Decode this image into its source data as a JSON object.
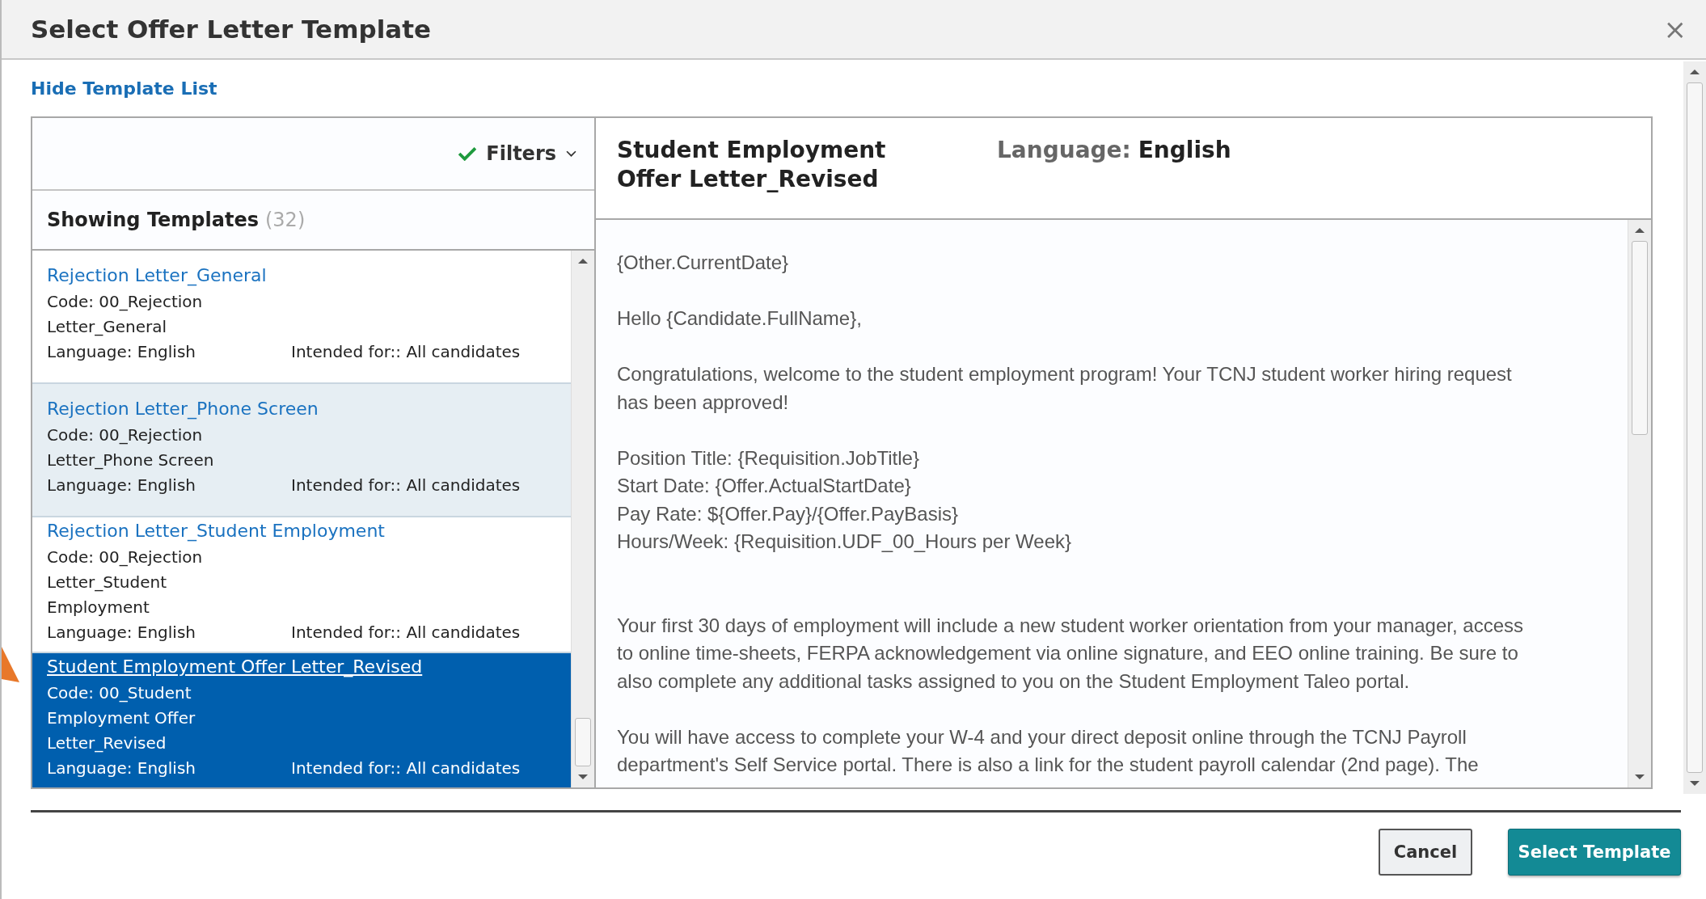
{
  "dialog": {
    "title": "Select Offer Letter Template",
    "close": "×"
  },
  "hide_link": "Hide Template List",
  "filters": {
    "label": "Filters",
    "active": true
  },
  "list": {
    "heading": "Showing Templates",
    "count": "(32)"
  },
  "templates": [
    {
      "title": "Rejection Letter_General",
      "code_lines": [
        "Code: 00_Rejection",
        "Letter_General"
      ],
      "language": "Language: English",
      "intended_for": "Intended for:: All candidates",
      "selected": false,
      "highlighted": false
    },
    {
      "title": "Rejection Letter_Phone Screen",
      "code_lines": [
        "Code: 00_Rejection",
        "Letter_Phone Screen"
      ],
      "language": "Language: English",
      "intended_for": "Intended for:: All candidates",
      "selected": false,
      "highlighted": true
    },
    {
      "title": "Rejection Letter_Student Employment",
      "code_lines": [
        "Code: 00_Rejection",
        "Letter_Student",
        "Employment"
      ],
      "language": "Language: English",
      "intended_for": "Intended for:: All candidates",
      "selected": false,
      "highlighted": false
    },
    {
      "title": "Student Employment Offer Letter_Revised",
      "code_lines": [
        "Code: 00_Student",
        "Employment Offer",
        "Letter_Revised"
      ],
      "language": "Language: English",
      "intended_for": "Intended for:: All candidates",
      "selected": true,
      "highlighted": false
    }
  ],
  "preview": {
    "title": "Student Employment Offer Letter_Revised",
    "language_label": "Language:",
    "language": "English",
    "paragraphs": [
      {
        "lines": [
          "{Other.CurrentDate}"
        ]
      },
      {
        "lines": [
          "Hello {Candidate.FullName},"
        ]
      },
      {
        "lines": [
          "Congratulations, welcome to the student employment program! Your TCNJ student worker hiring request",
          "has been approved!"
        ]
      },
      {
        "lines": [
          "Position Title: {Requisition.JobTitle}",
          "Start Date: {Offer.ActualStartDate}",
          "Pay Rate: ${Offer.Pay}/{Offer.PayBasis}",
          "Hours/Week: {Requisition.UDF_00_Hours per Week}"
        ]
      },
      {
        "lines": [
          "Your first 30 days of employment will include a new student worker orientation from your manager, access",
          "to online time-sheets, FERPA acknowledgement via online signature, and EEO online training. Be sure to",
          "also complete any additional tasks assigned to you on the Student Employment Taleo portal."
        ]
      },
      {
        "lines": [
          "You will have access to complete your W-4 and your direct deposit online through the TCNJ Payroll",
          "department's Self Service portal. There is also a link for the student payroll calendar (2nd page).  The"
        ]
      }
    ]
  },
  "buttons": [
    {
      "label": "Cancel",
      "kind": "secondary"
    },
    {
      "label": "Select Template",
      "kind": "primary"
    }
  ]
}
